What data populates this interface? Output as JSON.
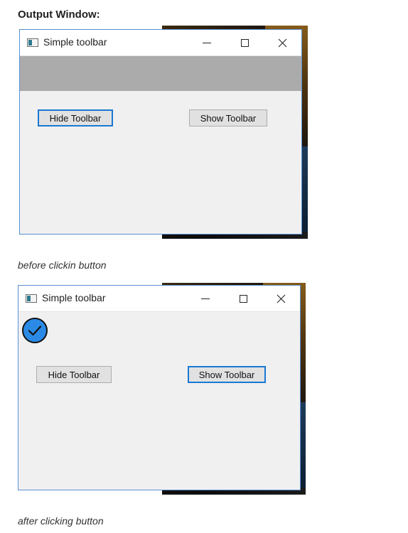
{
  "page": {
    "heading": "Output Window:",
    "caption_before": "before clickin button",
    "caption_after": "after clicking button"
  },
  "window_before": {
    "title": "Simple toolbar",
    "hide_button": "Hide Toolbar",
    "show_button": "Show Toolbar",
    "toolbar_visible": true,
    "focused_button": "hide"
  },
  "window_after": {
    "title": "Simple toolbar",
    "hide_button": "Hide Toolbar",
    "show_button": "Show Toolbar",
    "toolbar_visible": false,
    "focused_button": "show",
    "toolbar_icon": "check-circle-icon"
  },
  "colors": {
    "window_border": "#5a8fd0",
    "toolbar_gray": "#ababab",
    "focus_blue": "#1a78d4",
    "check_fill": "#2b8ae6"
  }
}
